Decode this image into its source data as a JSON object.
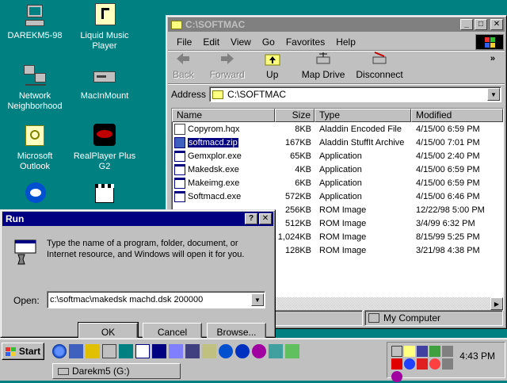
{
  "desktop": {
    "icons": [
      {
        "label": "DAREKM5-98"
      },
      {
        "label": "Liquid Music Player"
      },
      {
        "label": "Network Neighborhood"
      },
      {
        "label": "MacInMount"
      },
      {
        "label": "Microsoft Outlook"
      },
      {
        "label": "RealPlayer Plus G2"
      },
      {
        "label": ""
      },
      {
        "label": ""
      }
    ]
  },
  "explorer": {
    "title": "C:\\SOFTMAC",
    "menu": [
      "File",
      "Edit",
      "View",
      "Go",
      "Favorites",
      "Help"
    ],
    "toolbar": {
      "back": "Back",
      "forward": "Forward",
      "up": "Up",
      "map_drive": "Map Drive",
      "disconnect": "Disconnect"
    },
    "address_label": "Address",
    "address_value": "C:\\SOFTMAC",
    "columns": {
      "name": "Name",
      "size": "Size",
      "type": "Type",
      "modified": "Modified"
    },
    "files": [
      {
        "name": "Copyrom.hqx",
        "size": "8KB",
        "type": "Aladdin Encoded File",
        "modified": "4/15/00 6:59 PM"
      },
      {
        "name": "softmacd.zip",
        "size": "167KB",
        "type": "Aladdin StuffIt Archive",
        "modified": "4/15/00 7:01 PM"
      },
      {
        "name": "Gemxplor.exe",
        "size": "65KB",
        "type": "Application",
        "modified": "4/15/00 2:40 PM"
      },
      {
        "name": "Makedsk.exe",
        "size": "4KB",
        "type": "Application",
        "modified": "4/15/00 6:59 PM"
      },
      {
        "name": "Makeimg.exe",
        "size": "6KB",
        "type": "Application",
        "modified": "4/15/00 6:59 PM"
      },
      {
        "name": "Softmacd.exe",
        "size": "572KB",
        "type": "Application",
        "modified": "4/15/00 6:46 PM"
      },
      {
        "name": "",
        "size": "256KB",
        "type": "ROM Image",
        "modified": "12/22/98 5:00 PM"
      },
      {
        "name": "",
        "size": "512KB",
        "type": "ROM Image",
        "modified": "3/4/99 6:32 PM"
      },
      {
        "name": "",
        "size": "1,024KB",
        "type": "ROM Image",
        "modified": "8/15/99 5:25 PM"
      },
      {
        "name": "",
        "size": "128KB",
        "type": "ROM Image",
        "modified": "3/21/98 4:38 PM"
      }
    ],
    "status_zone": "My Computer"
  },
  "run": {
    "title": "Run",
    "help_glyph": "?",
    "close_glyph": "✕",
    "description": "Type the name of a program, folder, document, or Internet resource, and Windows will open it for you.",
    "open_label": "Open:",
    "command": "c:\\softmac\\makedsk machd.dsk 200000",
    "ok": "OK",
    "cancel": "Cancel",
    "browse": "Browse..."
  },
  "taskbar": {
    "start": "Start",
    "task": "Darekm5 (G:)",
    "clock": "4:43 PM"
  },
  "colors": {
    "desktop": "#008080",
    "titlebar": "#000080",
    "inactive_title": "#808080",
    "face": "#c0c0c0"
  }
}
